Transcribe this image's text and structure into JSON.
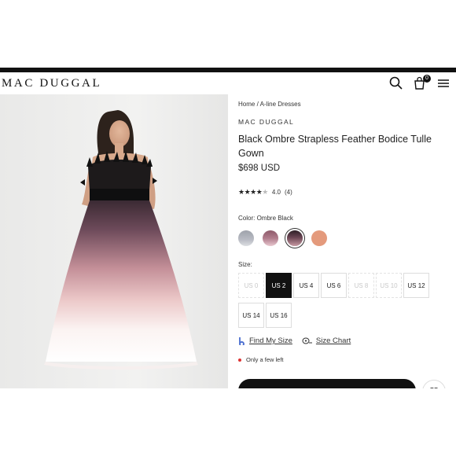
{
  "header": {
    "logo": "MAC DUGGAL",
    "cart_count": "0"
  },
  "breadcrumb": {
    "home": "Home",
    "separator": "/",
    "category": "A-line Dresses"
  },
  "product": {
    "brand": "MAC DUGGAL",
    "title": "Black Ombre Strapless Feather Bodice Tulle Gown",
    "price": "$698 USD",
    "rating_stars": 4.0,
    "rating_value": "4.0",
    "review_count": "(4)",
    "color_label": "Color:",
    "color_value": "Ombre Black",
    "size_label": "Size:",
    "swatches": [
      {
        "name": "silver",
        "color": "#b9bcc4",
        "selected": false
      },
      {
        "name": "mauve",
        "color": "#b07c8c",
        "selected": false
      },
      {
        "name": "ombre-black",
        "color": "#5a3a45",
        "selected": true
      },
      {
        "name": "coral",
        "color": "#e49a7c",
        "selected": false
      }
    ],
    "sizes": [
      {
        "label": "US 0",
        "available": false,
        "selected": false
      },
      {
        "label": "US 2",
        "available": true,
        "selected": true
      },
      {
        "label": "US 4",
        "available": true,
        "selected": false
      },
      {
        "label": "US 6",
        "available": true,
        "selected": false
      },
      {
        "label": "US 8",
        "available": false,
        "selected": false
      },
      {
        "label": "US 10",
        "available": false,
        "selected": false
      },
      {
        "label": "US 12",
        "available": true,
        "selected": false
      },
      {
        "label": "US 14",
        "available": true,
        "selected": false
      },
      {
        "label": "US 16",
        "available": true,
        "selected": false
      }
    ],
    "find_my_size": "Find My Size",
    "size_chart": "Size Chart",
    "stock_note": "Only a few left"
  }
}
